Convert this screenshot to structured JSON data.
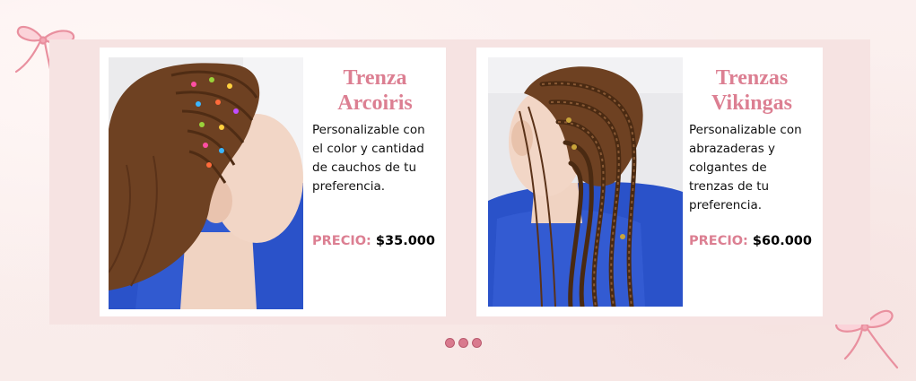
{
  "products": [
    {
      "title": "Trenza Arcoiris",
      "description": "Personalizable con el color y cantidad de cauchos de tu preferencia.",
      "price_label": "PRECIO:",
      "price_value": "$35.000"
    },
    {
      "title": "Trenzas Vikingas",
      "description": "Personalizable con abrazaderas y colgantes de trenzas de tu preferencia.",
      "price_label": "PRECIO:",
      "price_value": "$60.000"
    }
  ],
  "carousel": {
    "dot_count": 3
  },
  "colors": {
    "accent": "#dc7f92",
    "band": "#f6e3e2",
    "cape": "#2a52c9",
    "hair": "#6e4122"
  },
  "icons": [
    "ribbon-bow-icon",
    "ribbon-bow-icon"
  ]
}
